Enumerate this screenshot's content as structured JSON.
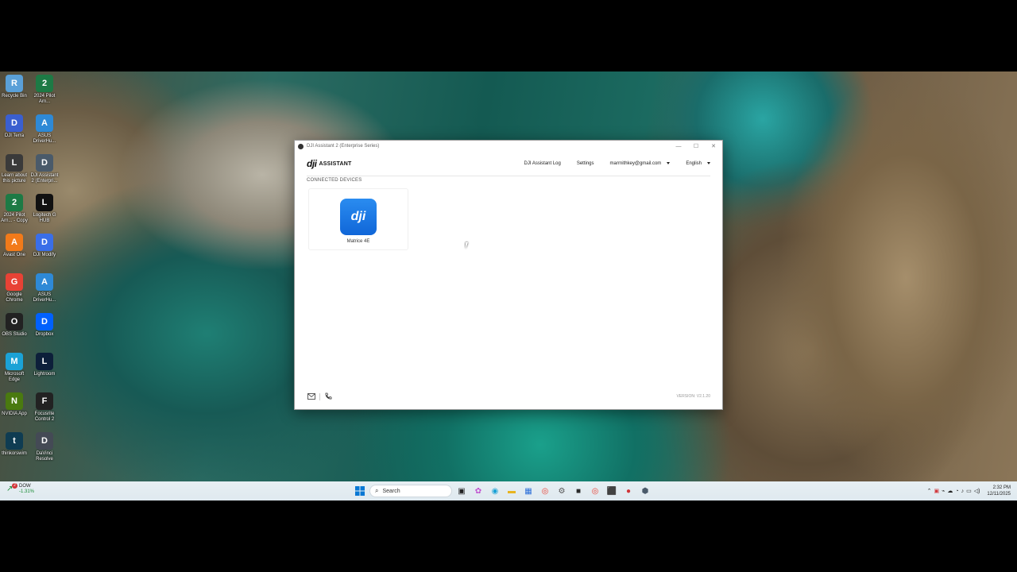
{
  "desktop": {
    "icons": [
      {
        "label": "Recycle Bin",
        "icon": "recycle-bin-icon",
        "color": "#5aa0d8"
      },
      {
        "label": "2024 Pilot Arn...",
        "icon": "excel-icon",
        "color": "#1d7a45"
      },
      {
        "label": "DJI Terra",
        "icon": "dji-terra-icon",
        "color": "#3a5fd0"
      },
      {
        "label": "ASUS DriverHu...",
        "icon": "asus-icon",
        "color": "#2e89d6"
      },
      {
        "label": "Learn about this picture",
        "icon": "learn-icon",
        "color": "#3a3a3a"
      },
      {
        "label": "DJI Assistant 2 (Enterpri...",
        "icon": "dji-assistant-icon",
        "color": "#4a5a6a"
      },
      {
        "label": "2024 Pilot Arn... - Copy",
        "icon": "excel-icon",
        "color": "#1d7a45"
      },
      {
        "label": "Logitech G HUB",
        "icon": "logitech-icon",
        "color": "#111111"
      },
      {
        "label": "Avast One",
        "icon": "avast-icon",
        "color": "#f27a1a"
      },
      {
        "label": "DJI Modify",
        "icon": "dji-modify-icon",
        "color": "#3a6ee8"
      },
      {
        "label": "Google Chrome",
        "icon": "chrome-icon",
        "color": "#e84235"
      },
      {
        "label": "ASUS DriverHu...",
        "icon": "asus-icon",
        "color": "#2e89d6"
      },
      {
        "label": "OBS Studio",
        "icon": "obs-icon",
        "color": "#222222"
      },
      {
        "label": "Dropbox",
        "icon": "dropbox-icon",
        "color": "#0061fe"
      },
      {
        "label": "Microsoft Edge",
        "icon": "edge-icon",
        "color": "#1ba2d6"
      },
      {
        "label": "Lightroom",
        "icon": "lightroom-icon",
        "color": "#0d1f3a"
      },
      {
        "label": "NVIDIA App",
        "icon": "nvidia-icon",
        "color": "#4a7a10"
      },
      {
        "label": "Focusrite Control 2",
        "icon": "focusrite-icon",
        "color": "#222222"
      },
      {
        "label": "thinkorswim",
        "icon": "thinkorswim-icon",
        "color": "#0f3c52"
      },
      {
        "label": "DaVinci Resolve",
        "icon": "davinci-icon",
        "color": "#444a55"
      }
    ]
  },
  "window": {
    "title": "DJI Assistant 2 (Enterprise Series)",
    "minimize": "—",
    "maximize": "☐",
    "close": "✕"
  },
  "app": {
    "logo_dji": "dji",
    "logo_text": "ASSISTANT",
    "nav": {
      "log": "DJI Assistant Log",
      "settings": "Settings",
      "account": "marrnithkey@gmail.com",
      "language": "English"
    },
    "section_title": "CONNECTED DEVICES",
    "device": {
      "name": "Matrice 4E",
      "logo": "dji"
    },
    "version": "VERSION: V2.1.20"
  },
  "taskbar": {
    "weather_badge": "2",
    "ticker": "DOW",
    "change": "-1.31%",
    "search_placeholder": "Search",
    "time": "2:32 PM",
    "date": "12/11/2025"
  }
}
